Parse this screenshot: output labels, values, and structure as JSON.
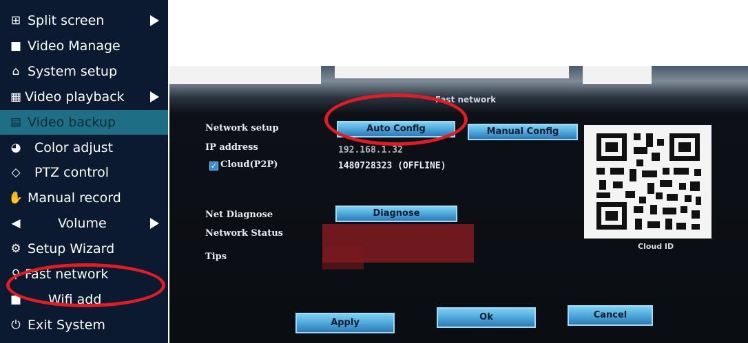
{
  "menu": {
    "items": [
      {
        "label": "Split screen",
        "icon": "grid-icon",
        "glyph": "⊞",
        "submenu": true,
        "selected": false
      },
      {
        "label": "Video Manage",
        "icon": "camera-icon",
        "glyph": "■",
        "submenu": false,
        "selected": false
      },
      {
        "label": "System setup",
        "icon": "home-icon",
        "glyph": "⌂",
        "submenu": false,
        "selected": false
      },
      {
        "label": "Video playback",
        "icon": "film-icon",
        "glyph": "▦",
        "submenu": true,
        "selected": false
      },
      {
        "label": "Video backup",
        "icon": "save-icon",
        "glyph": "▤",
        "submenu": false,
        "selected": true
      },
      {
        "label": "Color adjust",
        "icon": "palette-icon",
        "glyph": "◕",
        "submenu": false,
        "selected": false
      },
      {
        "label": "PTZ control",
        "icon": "diamond-icon",
        "glyph": "◇",
        "submenu": false,
        "selected": false
      },
      {
        "label": "Manual record",
        "icon": "hand-icon",
        "glyph": "✋",
        "submenu": false,
        "selected": false
      },
      {
        "label": "Volume",
        "icon": "speaker-icon",
        "glyph": "◀",
        "submenu": true,
        "selected": false
      },
      {
        "label": "Setup Wizard",
        "icon": "wizard-icon",
        "glyph": "⚙",
        "submenu": false,
        "selected": false
      },
      {
        "label": "Fast network",
        "icon": "network-icon",
        "glyph": "⚲",
        "submenu": false,
        "selected": false
      },
      {
        "label": "Wifi add",
        "icon": "wifi-camera-icon",
        "glyph": "■",
        "submenu": false,
        "selected": false
      },
      {
        "label": "Exit System",
        "icon": "power-icon",
        "glyph": "⏻",
        "submenu": false,
        "selected": false
      }
    ]
  },
  "dialog": {
    "title": "Fast network",
    "network_setup_label": "Network setup",
    "auto_config_label": "Auto Config",
    "manual_config_label": "Manual Config",
    "ip_address_label": "IP address",
    "ip_address_value": "192.168.1.32",
    "cloud_label": "Cloud(P2P)",
    "cloud_checked": true,
    "cloud_value": "1480728323 (OFFLINE)",
    "net_diagnose_label": "Net Diagnose",
    "diagnose_label": "Diagnose",
    "network_status_label": "Network Status",
    "tips_label": "Tips",
    "qr_caption": "Cloud ID",
    "apply_label": "Apply",
    "ok_label": "Ok",
    "cancel_label": "Cancel"
  },
  "colors": {
    "menu_bg": "#0b1a30",
    "menu_selected": "#1e6f86",
    "button": "#4aa3d8",
    "highlight_ring": "#e11c23",
    "redaction": "#7a1a1f"
  }
}
